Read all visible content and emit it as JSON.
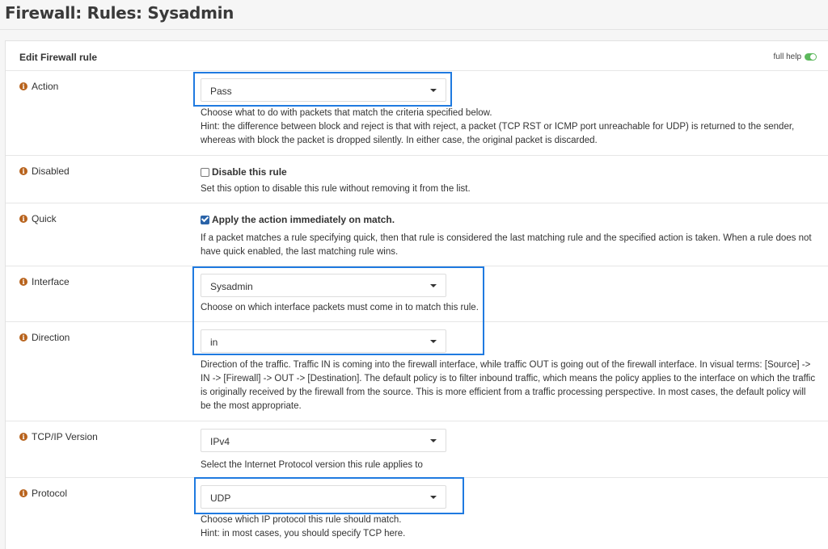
{
  "page": {
    "title": "Firewall: Rules: Sysadmin"
  },
  "panel": {
    "title": "Edit Firewall rule",
    "full_help": "full help"
  },
  "action": {
    "label": "Action",
    "value": "Pass",
    "help1": "Choose what to do with packets that match the criteria specified below.",
    "help2": "Hint: the difference between block and reject is that with reject, a packet (TCP RST or ICMP port unreachable for UDP) is returned to the sender,",
    "help3": "whereas with block the packet is dropped silently. In either case, the original packet is discarded."
  },
  "disabled": {
    "label": "Disabled",
    "checkbox_label": "Disable this rule",
    "checked": false,
    "help": "Set this option to disable this rule without removing it from the list."
  },
  "quick": {
    "label": "Quick",
    "checkbox_label": "Apply the action immediately on match.",
    "checked": true,
    "help1": "If a packet matches a rule specifying quick, then that rule is considered the last matching rule and the specified action is taken. When a rule does not",
    "help2": "have quick enabled, the last matching rule wins."
  },
  "interface": {
    "label": "Interface",
    "value": "Sysadmin",
    "help": "Choose on which interface packets must come in to match this rule."
  },
  "direction": {
    "label": "Direction",
    "value": "in",
    "help1": "Direction of the traffic. Traffic IN is coming into the firewall interface, while traffic OUT is going out of the firewall interface. In visual terms: [Source] ->",
    "help2": "IN -> [Firewall] -> OUT -> [Destination]. The default policy is to filter inbound traffic, which means the policy applies to the interface on which the traffic",
    "help3": "is originally received by the firewall from the source. This is more efficient from a traffic processing perspective. In most cases, the default policy will",
    "help4": "be the most appropriate."
  },
  "tcpip": {
    "label": "TCP/IP Version",
    "value": "IPv4",
    "help": "Select the Internet Protocol version this rule applies to"
  },
  "protocol": {
    "label": "Protocol",
    "value": "UDP",
    "help1": "Choose which IP protocol this rule should match.",
    "help2": "Hint: in most cases, you should specify TCP here."
  },
  "colors": {
    "highlight": "#1f7ae0",
    "info_icon": "#b8631d",
    "toggle_on": "#5cb85c",
    "checkbox": "#2a63a8"
  }
}
